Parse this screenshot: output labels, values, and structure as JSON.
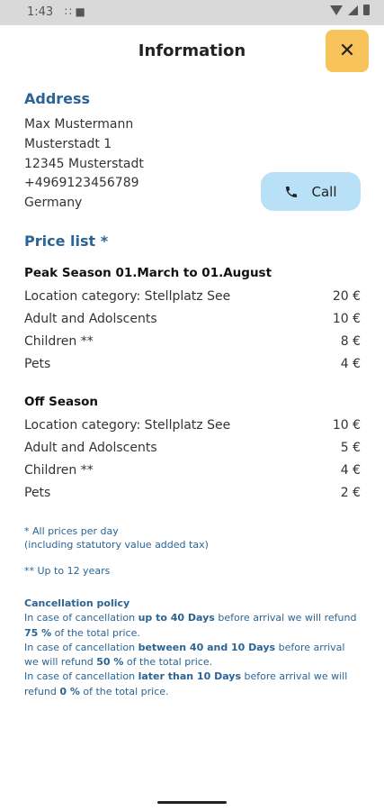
{
  "status": {
    "time": "1:43",
    "left_icons": "∷ ■"
  },
  "header": {
    "title": "Information",
    "close_icon": "close-icon"
  },
  "address": {
    "heading": "Address",
    "lines": [
      "Max Mustermann",
      "Musterstadt  1",
      "12345  Musterstadt",
      "+4969123456789",
      "Germany"
    ],
    "call_label": "Call"
  },
  "price_list": {
    "heading": "Price list *",
    "peak": {
      "title": "Peak Season  01.March to 01.August",
      "rows": [
        {
          "label": "Location category: Stellplatz See",
          "price": "20 €"
        },
        {
          "label": "Adult and Adolscents",
          "price": "10 €"
        },
        {
          "label": "Children **",
          "price": "8 €"
        },
        {
          "label": "Pets",
          "price": "4 €"
        }
      ]
    },
    "off": {
      "title": "Off Season",
      "rows": [
        {
          "label": "Location category: Stellplatz See",
          "price": "10 €"
        },
        {
          "label": "Adult and Adolscents",
          "price": "5 €"
        },
        {
          "label": "Children **",
          "price": "4 €"
        },
        {
          "label": "Pets",
          "price": "2 €"
        }
      ]
    },
    "note1_line1": "* All prices per day",
    "note1_line2": "(including statutory value added tax)",
    "note2": "** Up to 12 years"
  },
  "policy": {
    "heading": "Cancellation policy",
    "p1_a": "In case of cancellation ",
    "p1_b": "up to 40 Days",
    "p1_c": " before arrival we will refund ",
    "p1_d": "75 %",
    "p1_e": " of the total price.",
    "p2_a": "In case of cancellation ",
    "p2_b": "between 40  and  10 Days",
    "p2_c": " before arrival we will refund ",
    "p2_d": "50 %",
    "p2_e": " of the total price.",
    "p3_a": "In case of cancellation ",
    "p3_b": "later than 10 Days",
    "p3_c": " before arrival we will refund ",
    "p3_d": "0 %",
    "p3_e": " of the total price."
  }
}
